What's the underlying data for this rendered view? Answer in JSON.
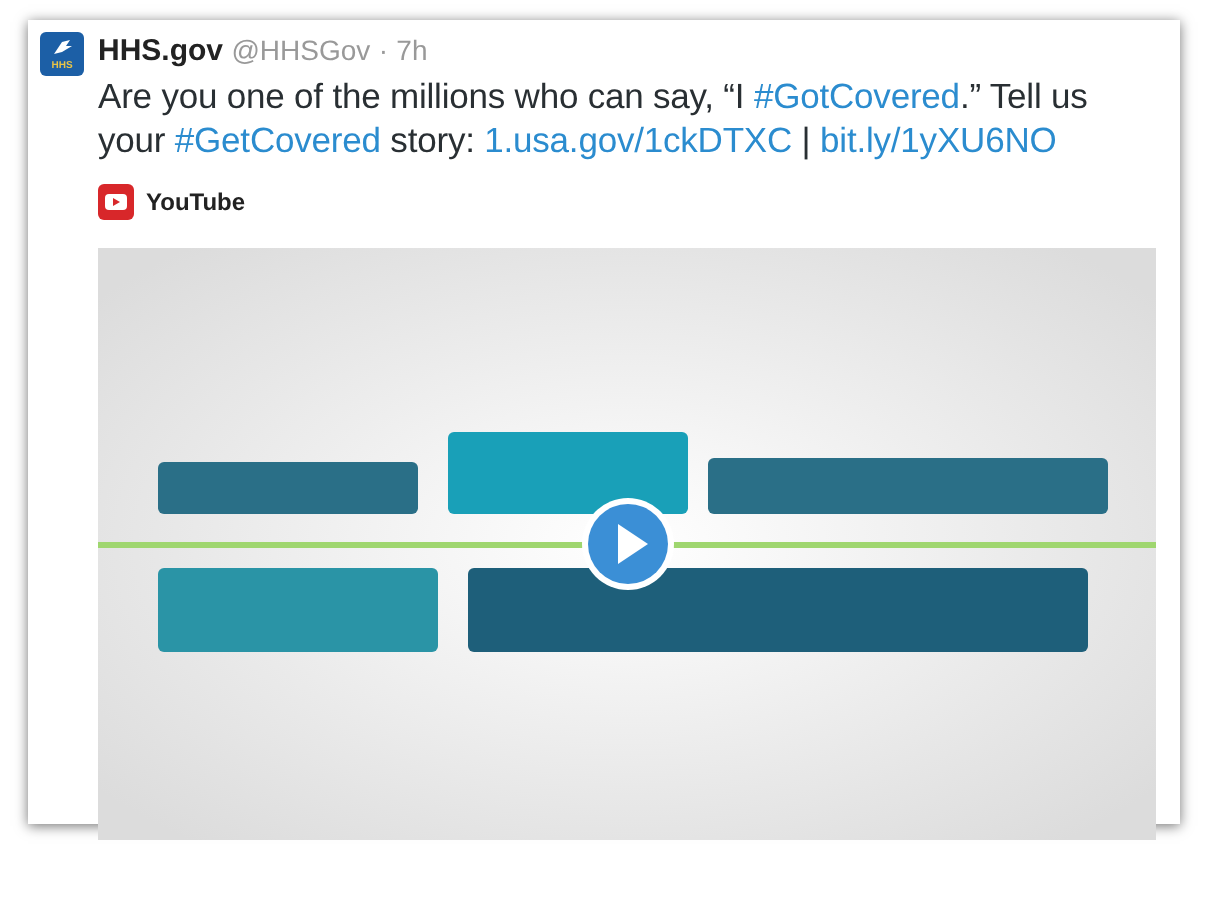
{
  "tweet": {
    "avatar": {
      "text": "HHS"
    },
    "name": "HHS.gov",
    "handle": "@HHSGov",
    "separator": "·",
    "time": "7h",
    "text": [
      {
        "kind": "plain",
        "text": "Are you one of the millions who can say, “I "
      },
      {
        "kind": "link",
        "text": "#GotCovered"
      },
      {
        "kind": "plain",
        "text": ".” Tell us your "
      },
      {
        "kind": "link",
        "text": "#GetCovered"
      },
      {
        "kind": "plain",
        "text": " story: "
      },
      {
        "kind": "link",
        "text": "1.usa.gov/1ckDTXC"
      },
      {
        "kind": "plain",
        "text": " | "
      },
      {
        "kind": "link",
        "text": "bit.ly/1yXU6NO"
      }
    ],
    "source": {
      "label": "YouTube"
    }
  }
}
